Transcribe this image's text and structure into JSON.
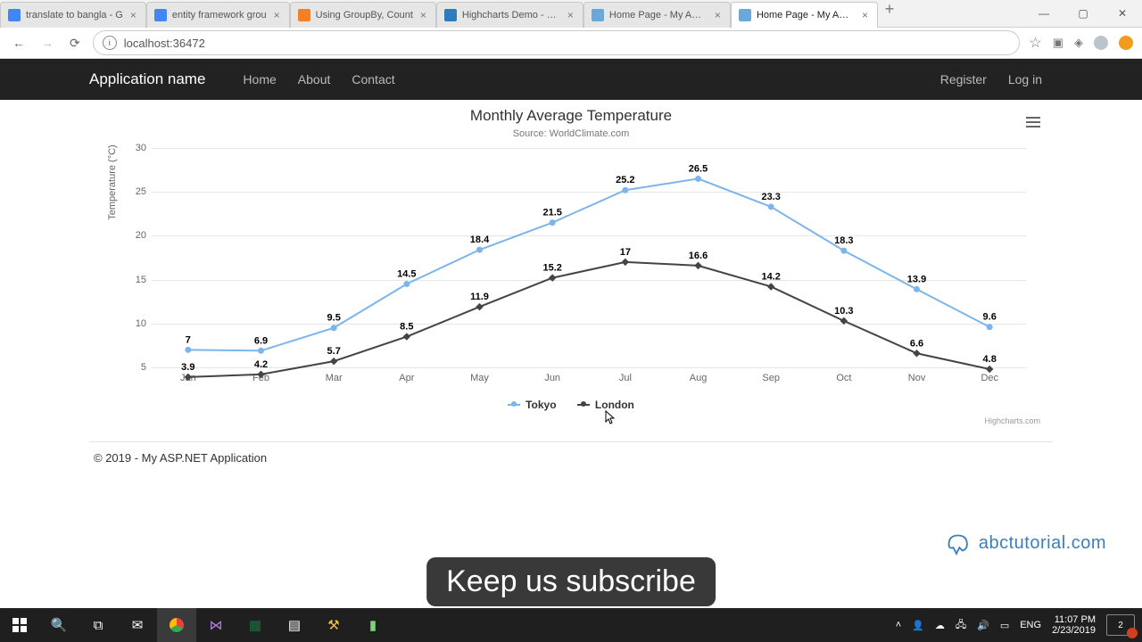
{
  "browser": {
    "tabs": [
      {
        "title": "translate to bangla - G",
        "fav": "#4285f4"
      },
      {
        "title": "entity framework grou",
        "fav": "#4285f4"
      },
      {
        "title": "Using GroupBy, Count",
        "fav": "#f48024"
      },
      {
        "title": "Highcharts Demo - JSF",
        "fav": "#2e7bbf"
      },
      {
        "title": "Home Page - My ASP.N",
        "fav": "#6aa8d8"
      },
      {
        "title": "Home Page - My ASP.N",
        "fav": "#6aa8d8"
      }
    ],
    "active_tab": 5,
    "url": "localhost:36472",
    "newtab": "+"
  },
  "nav": {
    "brand": "Application name",
    "links": [
      "Home",
      "About",
      "Contact"
    ],
    "right": [
      "Register",
      "Log in"
    ]
  },
  "chart_data": {
    "type": "line",
    "title": "Monthly Average Temperature",
    "subtitle": "Source: WorldClimate.com",
    "ylabel": "Temperature (°C)",
    "ylim": [
      5,
      30
    ],
    "yticks": [
      5,
      10,
      15,
      20,
      25,
      30
    ],
    "categories": [
      "Jan",
      "Feb",
      "Mar",
      "Apr",
      "May",
      "Jun",
      "Jul",
      "Aug",
      "Sep",
      "Oct",
      "Nov",
      "Dec"
    ],
    "series": [
      {
        "name": "Tokyo",
        "color": "#7cb5ec",
        "marker": "circle",
        "values": [
          7.0,
          6.9,
          9.5,
          14.5,
          18.4,
          21.5,
          25.2,
          26.5,
          23.3,
          18.3,
          13.9,
          9.6
        ]
      },
      {
        "name": "London",
        "color": "#434348",
        "marker": "diamond",
        "values": [
          3.9,
          4.2,
          5.7,
          8.5,
          11.9,
          15.2,
          17.0,
          16.6,
          14.2,
          10.3,
          6.6,
          4.8
        ]
      }
    ],
    "credit": "Highcharts.com"
  },
  "footer": "© 2019 - My ASP.NET Application",
  "brand_logo": "abctutorial.com",
  "overlay": "Keep us subscribe",
  "system": {
    "lang": "ENG",
    "time": "11:07 PM",
    "date": "2/23/2019",
    "notif_count": "2"
  }
}
